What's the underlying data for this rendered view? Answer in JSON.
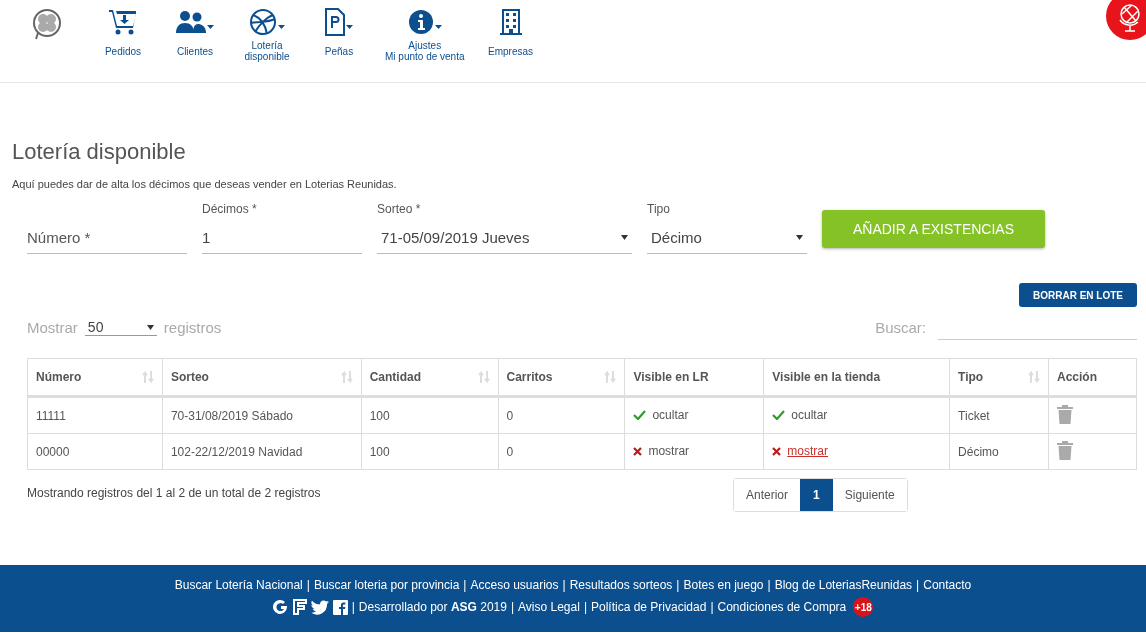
{
  "nav": {
    "items": [
      {
        "kind": "cart",
        "label": "Pedidos",
        "has_caret": false
      },
      {
        "kind": "users",
        "label": "Clientes",
        "has_caret": true
      },
      {
        "kind": "ball",
        "label": "Lotería\ndisponible",
        "has_caret": true
      },
      {
        "kind": "doc",
        "label": "Peñas",
        "has_caret": true
      },
      {
        "kind": "info",
        "label": "Ajustes\nMi punto de venta",
        "has_caret": true
      },
      {
        "kind": "building",
        "label": "Empresas",
        "has_caret": false
      }
    ]
  },
  "page": {
    "title": "Lotería disponible",
    "description": "Aquí puedes dar de alta los décimos que deseas vender en Loterias Reunidas."
  },
  "form": {
    "fields": [
      {
        "kind": "input",
        "placeholder": "Número *"
      },
      {
        "kind": "input",
        "label": "Décimos *",
        "value": "1"
      },
      {
        "kind": "select",
        "label": "Sorteo *",
        "value": "71-05/09/2019 Jueves"
      },
      {
        "kind": "select",
        "label": "Tipo",
        "value": "Décimo"
      }
    ],
    "submit": "AÑADIR A EXISTENCIAS"
  },
  "bulk_delete": "BORRAR EN LOTE",
  "table_controls": {
    "show_label": "Mostrar",
    "page_size": "50",
    "records_label": "registros",
    "search_label": "Buscar:"
  },
  "table": {
    "columns": [
      {
        "label": "Número",
        "sortable": true
      },
      {
        "label": "Sorteo",
        "sortable": true
      },
      {
        "label": "Cantidad",
        "sortable": true
      },
      {
        "label": "Carritos",
        "sortable": true
      },
      {
        "label": "Visible en LR",
        "sortable": false
      },
      {
        "label": "Visible en la tienda",
        "sortable": false
      },
      {
        "label": "Tipo",
        "sortable": true
      },
      {
        "label": "Acción",
        "sortable": false
      }
    ],
    "rows": [
      {
        "numero": "11111",
        "sorteo": "70-31/08/2019 Sábado",
        "cantidad": "100",
        "carritos": "0",
        "visible_lr": {
          "visible": true,
          "label": "ocultar",
          "link": false
        },
        "visible_tienda": {
          "visible": true,
          "label": "ocultar",
          "link": false
        },
        "tipo": "Ticket"
      },
      {
        "numero": "00000",
        "sorteo": "102-22/12/2019 Navidad",
        "cantidad": "100",
        "carritos": "0",
        "visible_lr": {
          "visible": false,
          "label": "mostrar",
          "link": false
        },
        "visible_tienda": {
          "visible": false,
          "label": "mostrar",
          "link": true
        },
        "tipo": "Décimo"
      }
    ]
  },
  "info": "Mostrando registros del 1 al 2 de un total de 2 registros",
  "pagination": {
    "previous": "Anterior",
    "pages": [
      {
        "label": "1",
        "selected": true
      }
    ],
    "next": "Siguiente"
  },
  "footer": {
    "line_1": [
      "Buscar Lotería Nacional",
      "Buscar loteria por provincia",
      "Acceso usuarios",
      "Resultados sorteos",
      "Botes en juego",
      "Blog de LoteriasReunidas",
      "Contacto"
    ],
    "separator": "|",
    "line_2": [
      "Desarrollado por **ASG** 2019",
      "Aviso Legal",
      "Política de Privacidad",
      "Condiciones de Compra"
    ],
    "age_badge": "+18"
  }
}
